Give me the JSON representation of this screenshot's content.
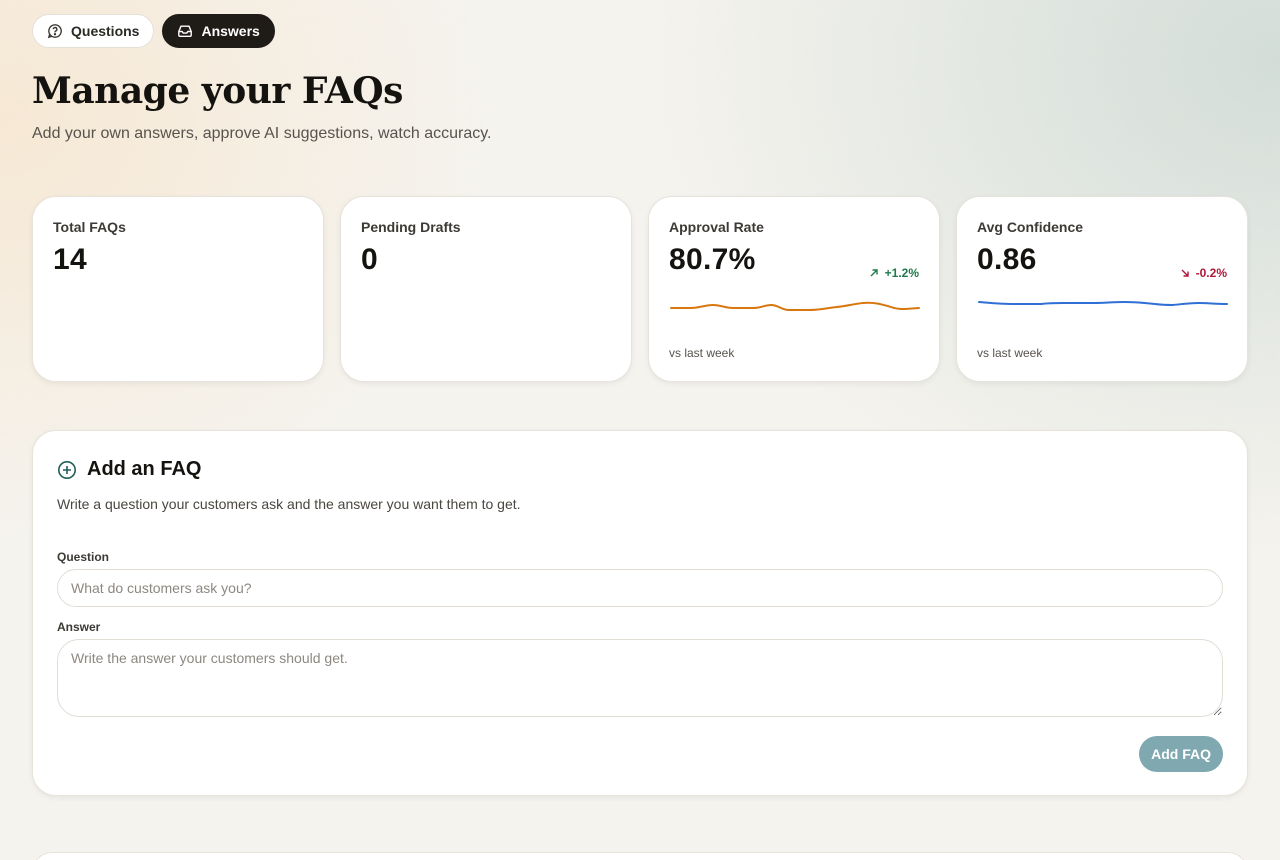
{
  "tabs": [
    {
      "label": "Questions",
      "icon": "question-circle-icon",
      "active": false
    },
    {
      "label": "Answers",
      "icon": "inbox-icon",
      "active": true
    }
  ],
  "header": {
    "title": "Manage your FAQs",
    "subtitle": "Add your own answers, approve AI suggestions, watch accuracy."
  },
  "stats": [
    {
      "label": "Total FAQs",
      "value": "14"
    },
    {
      "label": "Pending Drafts",
      "value": "0"
    },
    {
      "label": "Approval Rate",
      "value": "80.7%",
      "delta": "+1.2%",
      "trend": "up",
      "footnote": "vs last week",
      "color": "#d9770f"
    },
    {
      "label": "Avg Confidence",
      "value": "0.86",
      "delta": "-0.2%",
      "trend": "down",
      "footnote": "vs last week",
      "color": "#2f6fd6"
    }
  ],
  "add_faq": {
    "title": "Add an FAQ",
    "description": "Write a question your customers ask and the answer you want them to get.",
    "question_label": "Question",
    "question_placeholder": "What do customers ask you?",
    "answer_label": "Answer",
    "answer_placeholder": "Write the answer your customers should get.",
    "submit_label": "Add FAQ"
  },
  "colors": {
    "accent_dark": "#1f1b17",
    "button_disabled": "#7fa8b0",
    "positive": "#1e7a4d",
    "negative": "#b0173a",
    "icon_teal": "#1f5f5a"
  }
}
